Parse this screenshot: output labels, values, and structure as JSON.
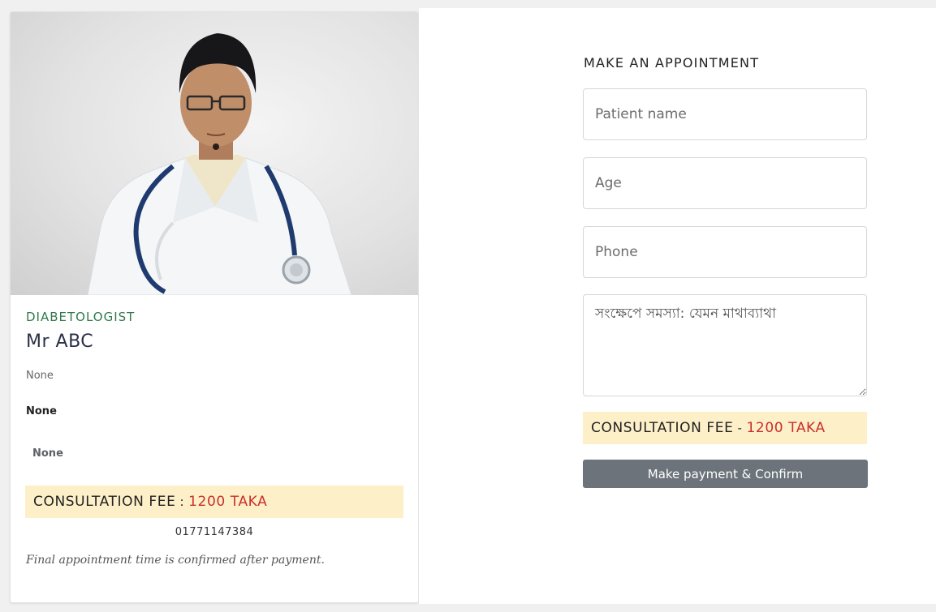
{
  "doctor": {
    "specialty": "DIABETOLOGIST",
    "name": "Mr ABC",
    "info_line1": "None",
    "info_line2": "None",
    "info_line3": "None",
    "fee_label": "CONSULTATION FEE",
    "fee_separator": ":",
    "fee_amount": "1200 TAKA",
    "phone": "01771147384",
    "note": "Final appointment time is confirmed after payment."
  },
  "form": {
    "title": "MAKE AN APPOINTMENT",
    "patient_name_placeholder": "Patient name",
    "age_placeholder": "Age",
    "phone_placeholder": "Phone",
    "problem_placeholder": "সংক্ষেপে সমস্যা: যেমন মাথাব্যাথা",
    "fee_label": "CONSULTATION FEE",
    "fee_separator": "-",
    "fee_amount": "1200 TAKA",
    "submit_label": "Make payment & Confirm"
  },
  "colors": {
    "accent_green": "#2f7a4a",
    "fee_red": "#c9302c",
    "fee_bg": "#fdf0c9",
    "button_gray": "#6c737b"
  }
}
